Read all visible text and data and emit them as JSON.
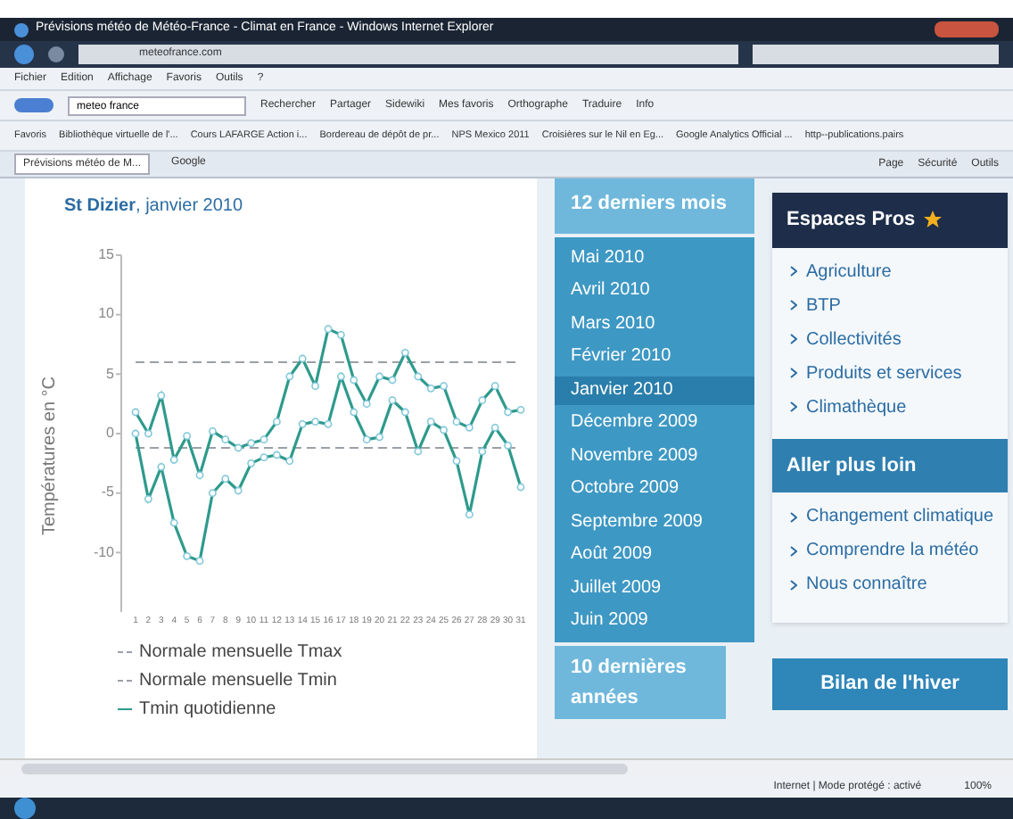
{
  "window": {
    "title": "Prévisions météo de Météo-France - Climat en France - Windows Internet Explorer"
  },
  "address_bar": {
    "value": "meteofrance.com"
  },
  "menu": [
    "Fichier",
    "Edition",
    "Affichage",
    "Favoris",
    "Outils",
    "?"
  ],
  "google_toolbar": {
    "query": "meteo france",
    "items": [
      "Rechercher",
      "Partager",
      "Sidewiki",
      "Mes favoris",
      "Orthographe",
      "Traduire",
      "Info"
    ]
  },
  "favorites_bar": [
    "Favoris",
    "Bibliothèque virtuelle de l'...",
    "Cours LAFARGE Action i...",
    "Bordereau de dépôt de pr...",
    "NPS Mexico 2011",
    "Croisières sur le Nil en Eg...",
    "Google Analytics Official ...",
    "http--publications.pairs"
  ],
  "tabs": [
    {
      "label": "Prévisions météo de M...",
      "selected": true
    },
    {
      "label": "Google",
      "selected": false
    }
  ],
  "command_bar": [
    "Page",
    "Sécurité",
    "Outils"
  ],
  "chart_panel": {
    "station": "St Dizier",
    "period": ", janvier 2010",
    "chart_data": {
      "type": "line",
      "ylabel": "Températures en °C",
      "x": [
        1,
        2,
        3,
        4,
        5,
        6,
        7,
        8,
        9,
        10,
        11,
        12,
        13,
        14,
        15,
        16,
        17,
        18,
        19,
        20,
        21,
        22,
        23,
        24,
        25,
        26,
        27,
        28,
        29,
        30,
        31
      ],
      "xlim": [
        1,
        31
      ],
      "ylim": [
        -15,
        15
      ],
      "yticks": [
        -10,
        -5,
        0,
        5,
        10,
        15
      ],
      "xticks": [
        1,
        2,
        3,
        4,
        5,
        6,
        7,
        8,
        9,
        10,
        11,
        12,
        13,
        14,
        15,
        16,
        17,
        18,
        19,
        20,
        21,
        22,
        23,
        24,
        25,
        26,
        27,
        28,
        29,
        30,
        31
      ],
      "series": [
        {
          "name": "Normale mensuelle Tmax",
          "color": "#9aa0a6",
          "line_style": "dashed",
          "values": [
            6,
            6,
            6,
            6,
            6,
            6,
            6,
            6,
            6,
            6,
            6,
            6,
            6,
            6,
            6,
            6,
            6,
            6,
            6,
            6,
            6,
            6,
            6,
            6,
            6,
            6,
            6,
            6,
            6,
            6,
            6
          ]
        },
        {
          "name": "Normale mensuelle Tmin",
          "color": "#9aa0a6",
          "line_style": "dashed",
          "values": [
            -1.2,
            -1.2,
            -1.2,
            -1.2,
            -1.2,
            -1.2,
            -1.2,
            -1.2,
            -1.2,
            -1.2,
            -1.2,
            -1.2,
            -1.2,
            -1.2,
            -1.2,
            -1.2,
            -1.2,
            -1.2,
            -1.2,
            -1.2,
            -1.2,
            -1.2,
            -1.2,
            -1.2,
            -1.2,
            -1.2,
            -1.2,
            -1.2,
            -1.2,
            -1.2,
            -1.2
          ]
        },
        {
          "name": "Tmin quotidienne",
          "color": "#2e9a8c",
          "line_style": "solid",
          "marker": "circle",
          "values": [
            0,
            -5.5,
            -2.8,
            -7.5,
            -10.3,
            -10.7,
            -5,
            -3.8,
            -4.8,
            -2.5,
            -2,
            -1.8,
            -2.3,
            0.8,
            1,
            0.8,
            4.8,
            1.8,
            -0.5,
            -0.3,
            2.8,
            1.8,
            -1.5,
            1,
            0.3,
            -2.3,
            -6.8,
            -1.5,
            0.5,
            -1,
            -4.5
          ]
        },
        {
          "color": "#2e9a8c",
          "line_style": "solid",
          "marker": "circle",
          "values": [
            1.8,
            0,
            3.2,
            -2.2,
            -0.2,
            -3.5,
            0.2,
            -0.5,
            -1.2,
            -0.8,
            -0.5,
            1,
            4.8,
            6.3,
            4,
            8.8,
            8.3,
            4.5,
            2.5,
            4.8,
            4.5,
            6.8,
            4.8,
            3.8,
            4,
            1,
            0.5,
            2.8,
            4,
            1.8,
            2
          ]
        }
      ]
    }
  },
  "months_panel": {
    "header": "12 derniers mois",
    "months": [
      {
        "label": "Mai 2010",
        "selected": false
      },
      {
        "label": "Avril 2010",
        "selected": false
      },
      {
        "label": "Mars 2010",
        "selected": false
      },
      {
        "label": "Février 2010",
        "selected": false
      },
      {
        "label": "Janvier 2010",
        "selected": true
      },
      {
        "label": "Décembre 2009",
        "selected": false
      },
      {
        "label": "Novembre 2009",
        "selected": false
      },
      {
        "label": "Octobre 2009",
        "selected": false
      },
      {
        "label": "Septembre 2009",
        "selected": false
      },
      {
        "label": "Août 2009",
        "selected": false
      },
      {
        "label": "Juillet 2009",
        "selected": false
      },
      {
        "label": "Juin 2009",
        "selected": false
      }
    ],
    "footer": "10 dernières années"
  },
  "sidebar": {
    "espaces_pros": {
      "title": "Espaces Pros",
      "links": [
        "Agriculture",
        "BTP",
        "Collectivités",
        "Produits et services",
        "Climathèque"
      ]
    },
    "aller_plus_loin": {
      "title": "Aller plus loin",
      "links": [
        "Changement climatique",
        "Comprendre la météo",
        "Nous connaître"
      ]
    },
    "bilan_button": "Bilan de l'hiver"
  },
  "status_bar": {
    "zone": "Internet | Mode protégé : activé",
    "zoom": "100%"
  }
}
